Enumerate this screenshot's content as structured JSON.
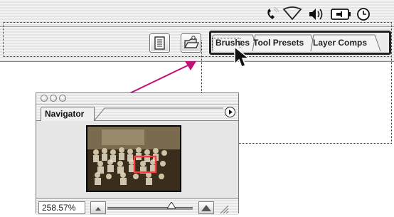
{
  "menubar": {
    "icons": [
      "phone-signal-icon",
      "wifi-icon",
      "volume-icon",
      "battery-plug-icon",
      "clock-icon"
    ]
  },
  "toolbar": {
    "buttons": [
      "palette-toggle-icon",
      "file-browser-icon"
    ],
    "palette_well": {
      "tabs": [
        {
          "label": "Brushes"
        },
        {
          "label": "Tool Presets"
        },
        {
          "label": "Layer Comps"
        }
      ]
    }
  },
  "navigator": {
    "tab_label": "Navigator",
    "zoom_value": "258.57%",
    "zoom_slider_fraction": 0.75
  },
  "colors": {
    "arrow": "#c1127a",
    "view_box": "#ff3b3b"
  }
}
